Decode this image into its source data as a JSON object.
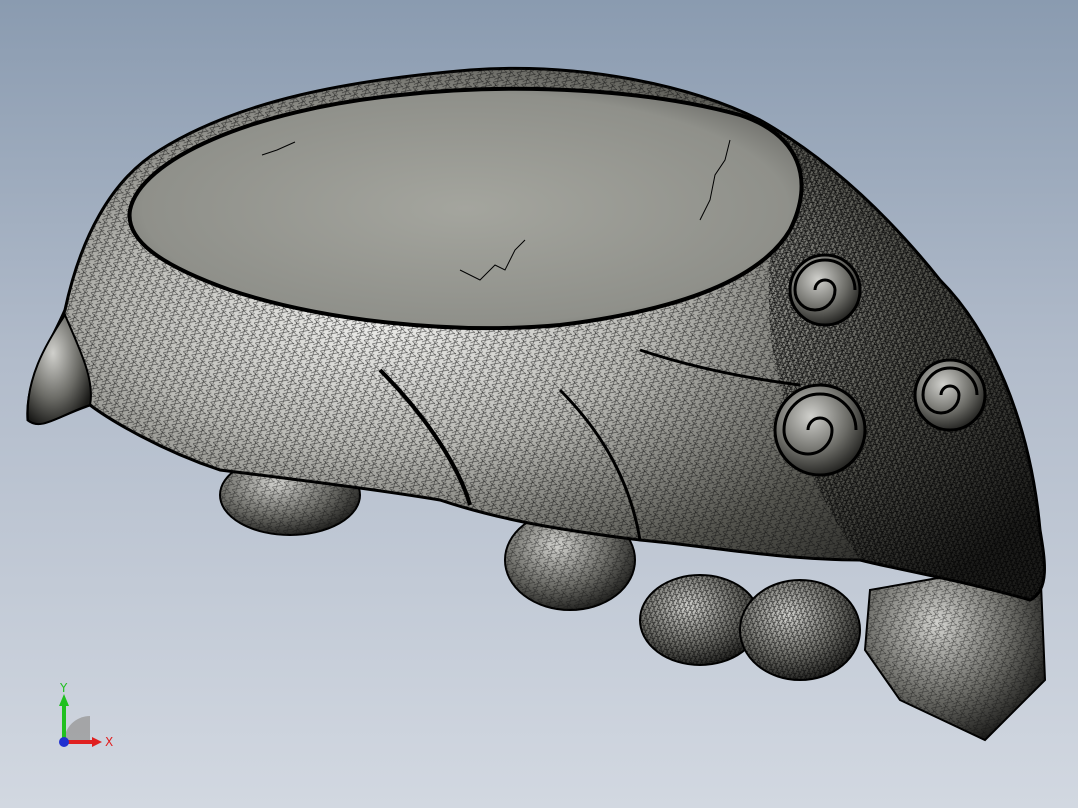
{
  "viewport": {
    "background_top": "#8a9bb0",
    "background_bottom": "#d2d8e1"
  },
  "model": {
    "name": "organic-bowl-mesh",
    "mesh_color": "#1a1a1a",
    "surface_color": "#8f8f8a",
    "rim_face_color": "#9c9d95"
  },
  "triad": {
    "x_label": "X",
    "y_label": "Y",
    "x_color": "#e02020",
    "y_color": "#20c020",
    "z_color": "#2030d0"
  }
}
